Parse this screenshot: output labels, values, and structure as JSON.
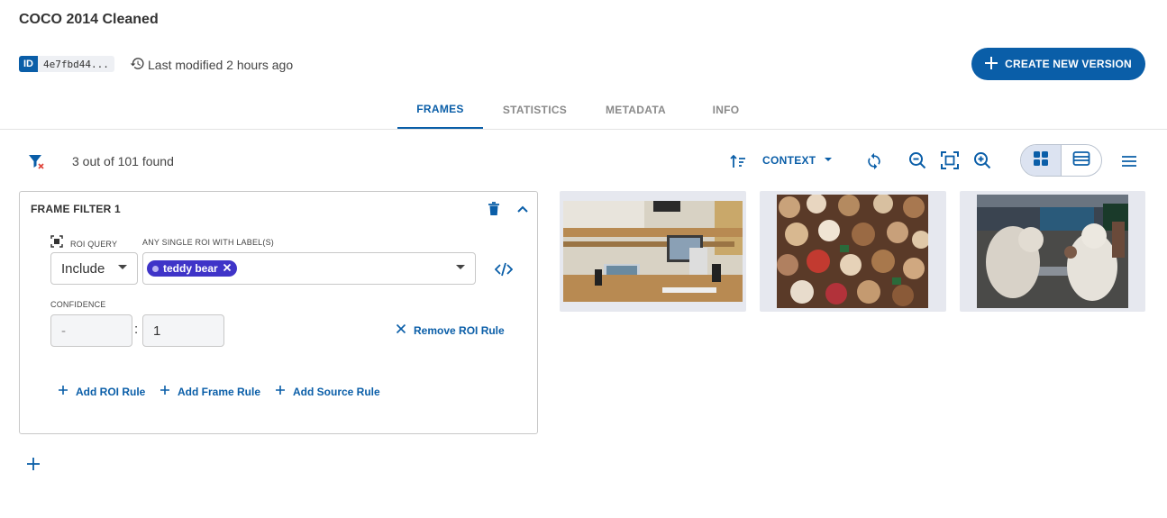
{
  "header": {
    "title": "COCO 2014 Cleaned",
    "id_tag": "ID",
    "id_value": "4e7fbd44...",
    "last_modified": "Last modified 2 hours ago",
    "create_button": "CREATE NEW VERSION"
  },
  "tabs": [
    {
      "label": "FRAMES",
      "active": true
    },
    {
      "label": "STATISTICS",
      "active": false
    },
    {
      "label": "METADATA",
      "active": false
    },
    {
      "label": "INFO",
      "active": false
    }
  ],
  "toolbar": {
    "result_count": "3 out of 101 found",
    "context_label": "CONTEXT",
    "view_mode": "grid"
  },
  "filter": {
    "title": "FRAME FILTER 1",
    "roi_query_label": "ROI QUERY",
    "label_field_label": "ANY SINGLE ROI WITH LABEL(S)",
    "roi_query_value": "Include",
    "selected_labels": [
      "teddy bear"
    ],
    "confidence_label": "CONFIDENCE",
    "confidence_min_placeholder": "-",
    "confidence_separator": ":",
    "confidence_max": "1",
    "remove_rule": "Remove ROI Rule",
    "add_roi_rule": "Add ROI Rule",
    "add_frame_rule": "Add Frame Rule",
    "add_source_rule": "Add Source Rule"
  },
  "frames": [
    {
      "icon": "desk-computer-photo"
    },
    {
      "icon": "teddy-bear-pile-photo"
    },
    {
      "icon": "giant-teddy-bears-photo"
    }
  ],
  "colors": {
    "accent": "#0a5ea8",
    "chip": "#3f34c8",
    "filter_clear": "#e0473e"
  }
}
